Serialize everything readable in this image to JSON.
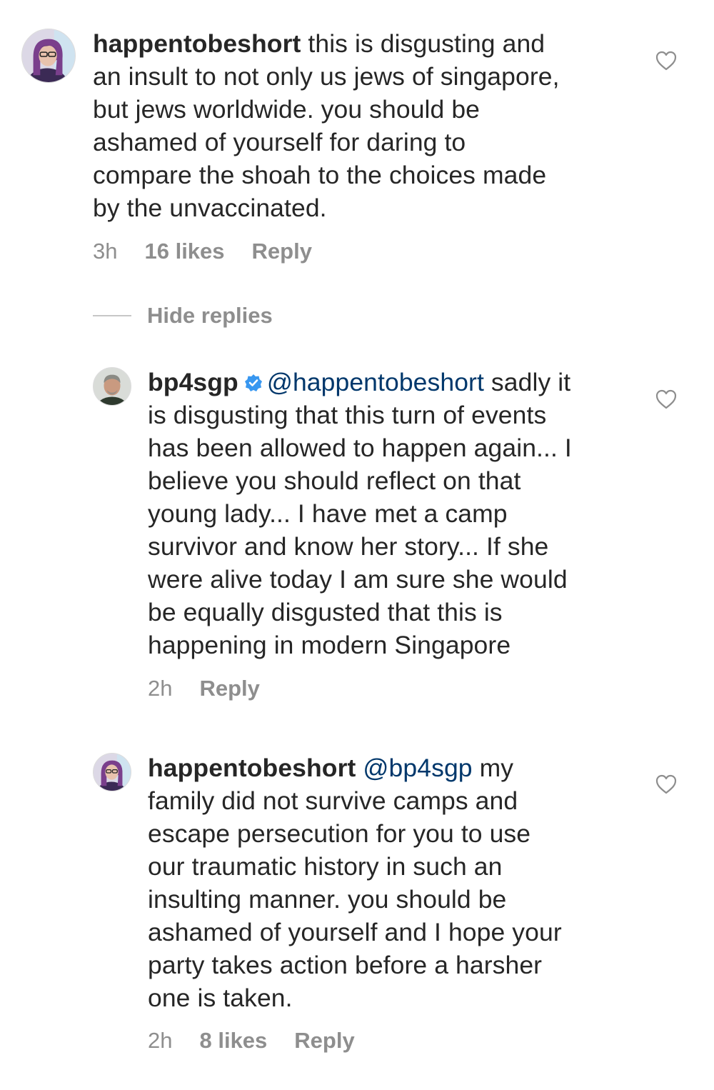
{
  "colors": {
    "text": "#262626",
    "secondary": "#8e8e8e",
    "mention": "#00376b",
    "verified": "#3897f0"
  },
  "comments": [
    {
      "username": "happentobeshort",
      "verified": false,
      "mention": "",
      "lines": [
        " this is disgusting and",
        "an insult to not only us jews of singapore,",
        "but jews worldwide. you should be",
        "ashamed of yourself for daring to",
        "compare the shoah to the choices made",
        "by the unvaccinated."
      ],
      "time": "3h",
      "likes": "16 likes",
      "reply_label": "Reply",
      "like_icon": "heart-outline-icon"
    },
    {
      "username": "bp4sgp",
      "verified": true,
      "verified_icon": "verified-badge-icon",
      "mention": "@happentobeshort",
      "lines": [
        " sadly it",
        "is disgusting that this turn of events",
        "has been allowed to happen again... I",
        "believe you should reflect on that",
        "young lady... I have met a camp",
        "survivor and know her story... If she",
        "were alive today I am sure she would",
        "be equally disgusted that this is",
        "happening in modern Singapore"
      ],
      "time": "2h",
      "reply_label": "Reply",
      "like_icon": "heart-outline-icon"
    },
    {
      "username": "happentobeshort",
      "verified": false,
      "mention": "@bp4sgp",
      "lines": [
        " my",
        "family did not survive camps and",
        "escape persecution for you to use",
        "our traumatic history in such an",
        "insulting manner. you should be",
        "ashamed of yourself and I hope your",
        "party takes action before a harsher",
        "one is taken."
      ],
      "time": "2h",
      "likes": "8 likes",
      "reply_label": "Reply",
      "like_icon": "heart-outline-icon"
    }
  ],
  "hide_replies_label": "Hide replies"
}
